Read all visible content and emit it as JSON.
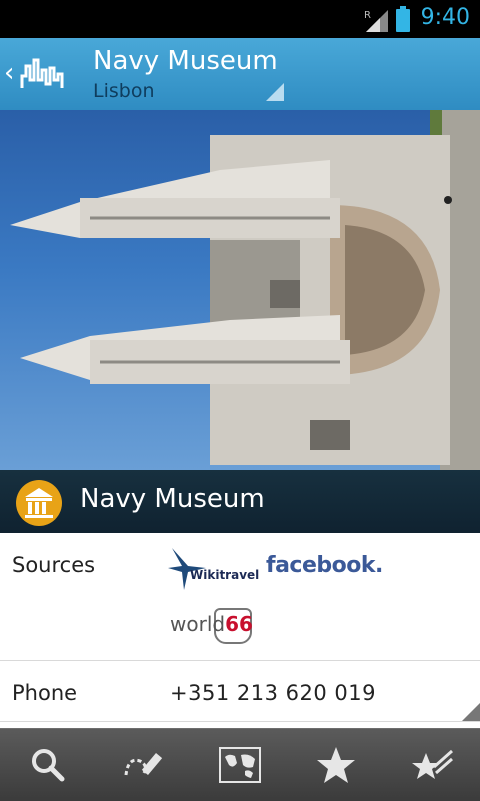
{
  "status_bar": {
    "time": "9:40",
    "network_indicator": "R",
    "signal_icon": "signal-icon",
    "battery_icon": "battery-icon"
  },
  "action_bar": {
    "title": "Navy Museum",
    "subtitle": "Lisbon",
    "up_icon": "chevron-left-icon",
    "logo_icon": "city-skyline-logo",
    "dropdown_icon": "dropdown-corner-icon"
  },
  "hero": {
    "alt": "photo of Navy Museum"
  },
  "place_header": {
    "name": "Navy Museum",
    "category_icon": "museum-icon",
    "category_color": "#e8a317"
  },
  "details": {
    "sources_label": "Sources",
    "sources": {
      "wikitravel": "Wikitravel",
      "facebook": "facebook.",
      "world66_prefix": "world",
      "world66_number": "66"
    },
    "phone_label": "Phone",
    "phone_value": "+351 213 620 019"
  },
  "bottom_bar": {
    "tabs": [
      {
        "icon": "search-icon"
      },
      {
        "icon": "route-edit-icon"
      },
      {
        "icon": "map-icon"
      },
      {
        "icon": "star-icon"
      },
      {
        "icon": "starred-places-icon"
      }
    ]
  },
  "colors": {
    "accent": "#33b5e5",
    "action_bar": "#3a99cf",
    "header_bg": "#17303f",
    "facebook": "#3b5998",
    "world66": "#c8102e"
  }
}
